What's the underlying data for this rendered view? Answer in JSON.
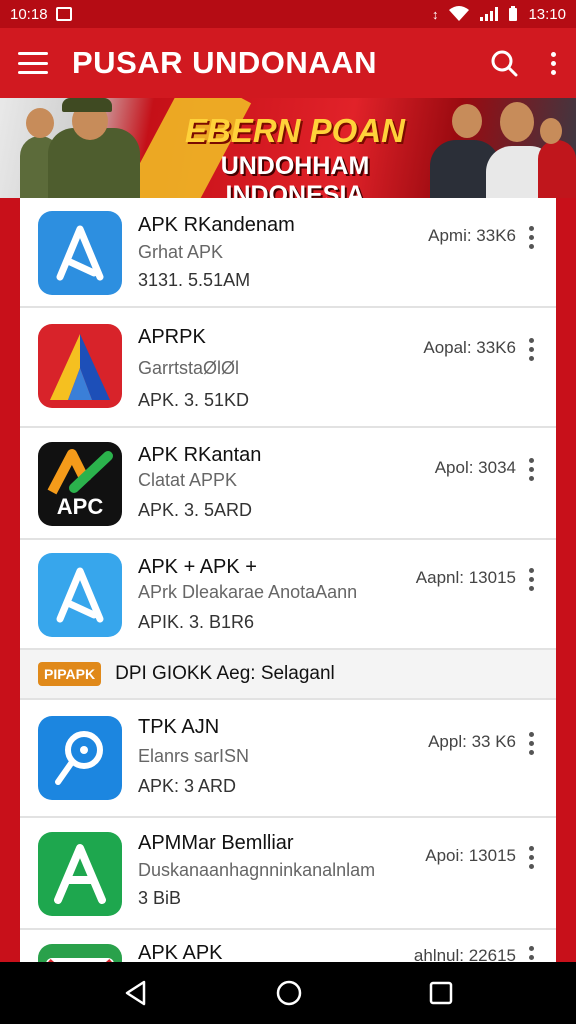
{
  "status_bar": {
    "time_left": "10:18",
    "time_right": "13:10"
  },
  "app_bar": {
    "title": "PUSAR UNDONAAN"
  },
  "banner": {
    "line1": "EBERN POAN",
    "line2": "UNDOHHAM INDONESIA"
  },
  "apps": [
    {
      "name": "APK RKandenam",
      "subtitle": "Grhat APK",
      "meta": "3131. 5.51AM",
      "version": "Apmi: 33K6",
      "icon": "blue-a-icon",
      "color": "#2d8fe0"
    },
    {
      "name": "APRPK",
      "subtitle": "GarrtstaØlØl",
      "meta": "APK. 3. 51KD",
      "version": "Aopal: 33K6",
      "icon": "red-a-icon",
      "color": "#d8232a"
    },
    {
      "name": "APK RKantan",
      "subtitle": "Clatat APPK",
      "meta": "APK. 3. 5ARD",
      "version": "Apol: 3034",
      "icon": "apc-icon",
      "color": "#111111"
    },
    {
      "name": "APK + APK +",
      "subtitle": "APrk Dleakarae AnotaAann",
      "meta": "APIK. 3. B1R6",
      "version": "Aapnl: 13015",
      "icon": "blue-a-icon",
      "color": "#37a6ec"
    },
    {
      "name": "TPK AJN",
      "subtitle": "Elanrs sarISN",
      "meta": "APK: 3 ARD",
      "version": "Appl: 33 K6",
      "icon": "pin-icon",
      "color": "#1c86e0"
    },
    {
      "name": "APMMar Bemlliar",
      "subtitle": "Duskanaanhagnninkanalnlam",
      "meta": "3 BiB",
      "version": "Apoi: 13015",
      "icon": "green-a-icon",
      "color": "#1ea74e"
    },
    {
      "name": "APK APK",
      "subtitle": "",
      "meta": "",
      "version": "ahlnul: 22615",
      "icon": "gmail-icon",
      "color": "#2aa14b"
    }
  ],
  "promo": {
    "tag": "PIPAPK",
    "text": "DPI GIOKK Aeg: Selaganl"
  },
  "nav": {
    "back": "back-icon",
    "home": "home-icon",
    "recents": "recents-icon"
  }
}
